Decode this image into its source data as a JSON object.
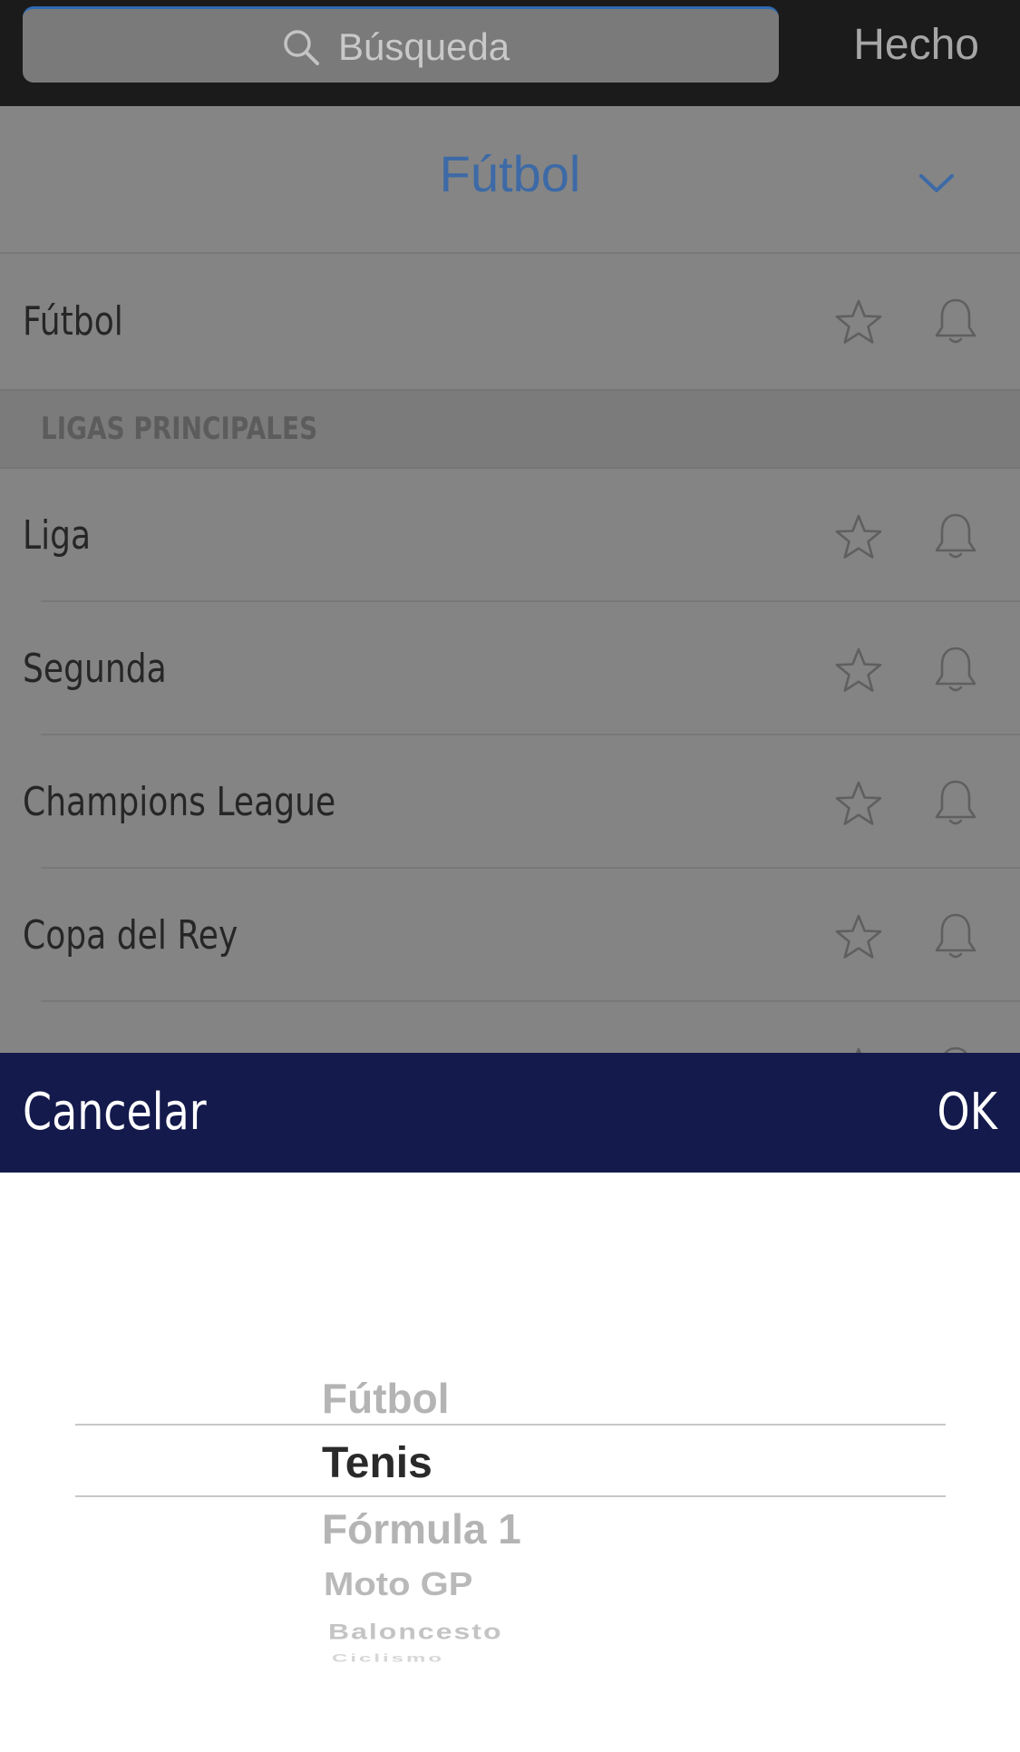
{
  "search": {
    "placeholder": "Búsqueda",
    "done_label": "Hecho"
  },
  "selector": {
    "title": "Fútbol"
  },
  "list": {
    "top_item": "Fútbol",
    "section_header": "LIGAS PRINCIPALES",
    "items": [
      "Liga",
      "Segunda",
      "Champions League",
      "Copa del Rey"
    ]
  },
  "toolbar": {
    "cancel_label": "Cancelar",
    "ok_label": "OK"
  },
  "picker": {
    "selected": "Tenis",
    "options": [
      "Fútbol",
      "Tenis",
      "Fórmula 1",
      "Moto GP",
      "Baloncesto",
      "Ciclismo"
    ]
  },
  "colors": {
    "accent": "#3d6aa6",
    "toolbar_bg": "#141a4b",
    "search_bar_bg": "#1b1b1b"
  },
  "icons": {
    "search": "search-icon",
    "chevron": "chevron-down-icon",
    "favorite": "star-icon",
    "notification": "bell-icon"
  }
}
